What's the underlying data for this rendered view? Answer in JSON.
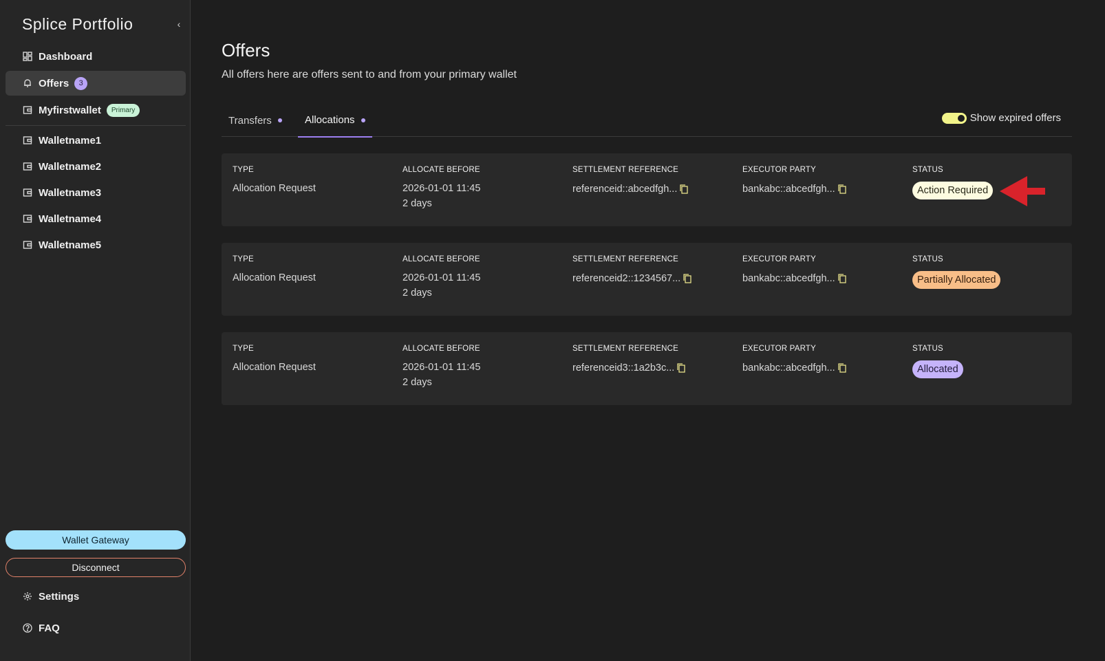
{
  "sidebar": {
    "brand": "Splice Portfolio",
    "items": [
      {
        "label": "Dashboard",
        "icon": "grid-icon"
      },
      {
        "label": "Offers",
        "icon": "bell-icon",
        "badge": "3"
      },
      {
        "label": "Myfirstwallet",
        "icon": "wallet-icon",
        "tag": "Primary"
      },
      {
        "label": "Walletname1",
        "icon": "wallet-icon"
      },
      {
        "label": "Walletname2",
        "icon": "wallet-icon"
      },
      {
        "label": "Walletname3",
        "icon": "wallet-icon"
      },
      {
        "label": "Walletname4",
        "icon": "wallet-icon"
      },
      {
        "label": "Walletname5",
        "icon": "wallet-icon"
      }
    ],
    "wallet_gateway": "Wallet Gateway",
    "disconnect": "Disconnect",
    "settings": "Settings",
    "faq": "FAQ"
  },
  "main": {
    "title": "Offers",
    "subtitle": "All offers here are offers sent to and from your primary wallet",
    "tabs": [
      {
        "label": "Transfers"
      },
      {
        "label": "Allocations"
      }
    ],
    "show_expired_label": "Show expired offers",
    "show_expired_on": true,
    "columns": {
      "type": "TYPE",
      "allocate_before": "ALLOCATE BEFORE",
      "settlement_reference": "SETTLEMENT REFERENCE",
      "executor_party": "EXECUTOR PARTY",
      "status": "STATUS"
    },
    "rows": [
      {
        "type": "Allocation Request",
        "date": "2026-01-01 11:45",
        "relative": "2 days",
        "settlement_reference": "referenceid::abcedfgh...",
        "executor_party": "bankabc::abcedfgh...",
        "status": "Action Required"
      },
      {
        "type": "Allocation Request",
        "date": "2026-01-01 11:45",
        "relative": "2 days",
        "settlement_reference": "referenceid2::1234567...",
        "executor_party": "bankabc::abcedfgh...",
        "status": "Partially Allocated"
      },
      {
        "type": "Allocation Request",
        "date": "2026-01-01 11:45",
        "relative": "2 days",
        "settlement_reference": "referenceid3::1a2b3c...",
        "executor_party": "bankabc::abcedfgh...",
        "status": "Allocated"
      }
    ]
  },
  "colors": {
    "accent": "#9c7ef0",
    "gateway": "#a3e1fb",
    "disconnect_border": "#e2826a",
    "status_action_required": "#fdfbe0",
    "status_partially_allocated": "#f8be88",
    "status_allocated": "#c5b3fa",
    "arrow": "#d9232b"
  }
}
